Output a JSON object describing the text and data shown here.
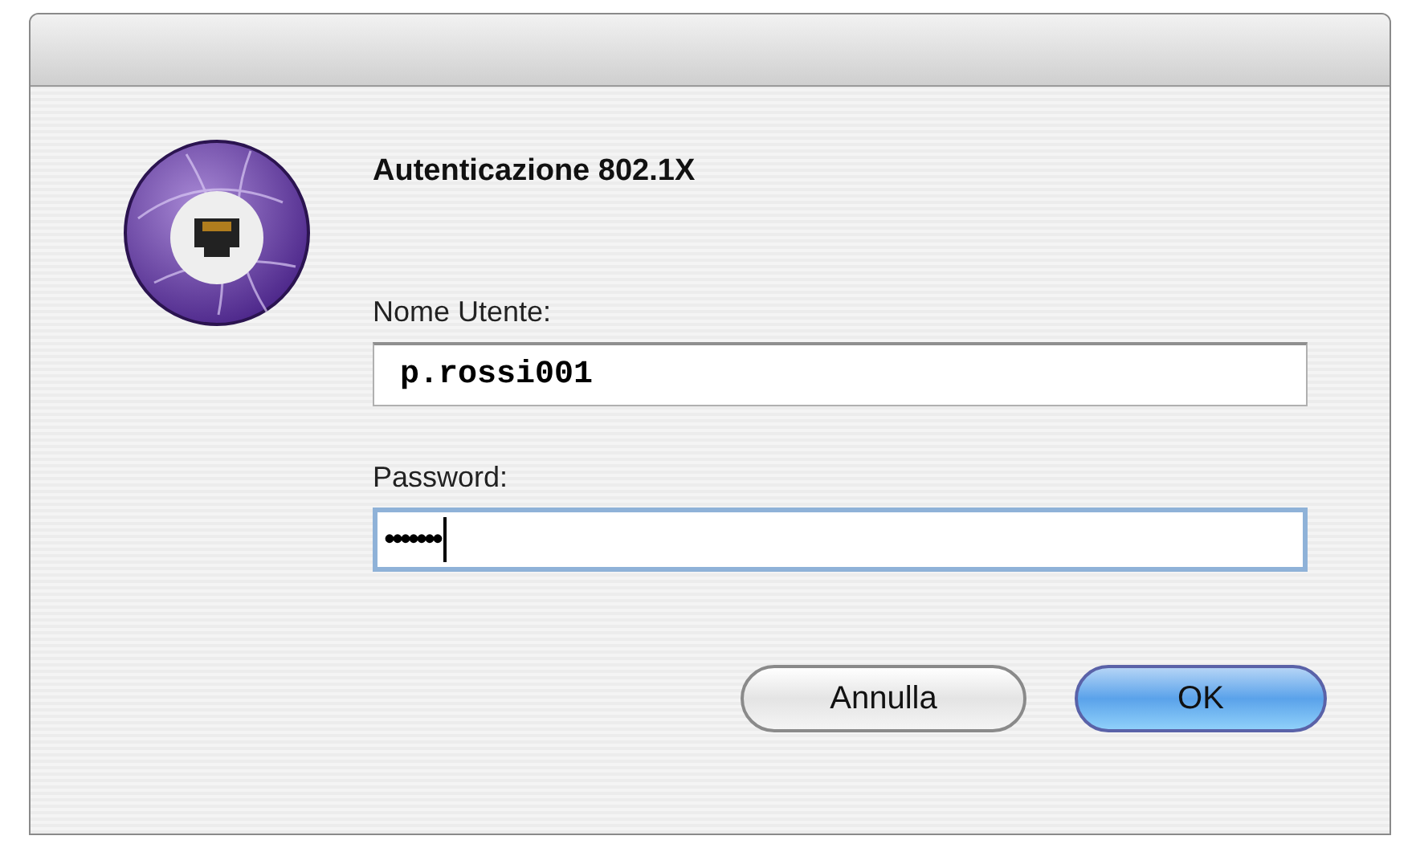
{
  "dialog": {
    "heading": "Autenticazione 802.1X"
  },
  "fields": [
    {
      "label": "Nome Utente:",
      "value": "p.rossi001",
      "kind": "text",
      "focused": false
    },
    {
      "label": "Password:",
      "value": "•••••••",
      "kind": "password",
      "focused": true
    }
  ],
  "buttons": [
    {
      "label": "Annulla",
      "default": false
    },
    {
      "label": "OK",
      "default": true
    }
  ]
}
